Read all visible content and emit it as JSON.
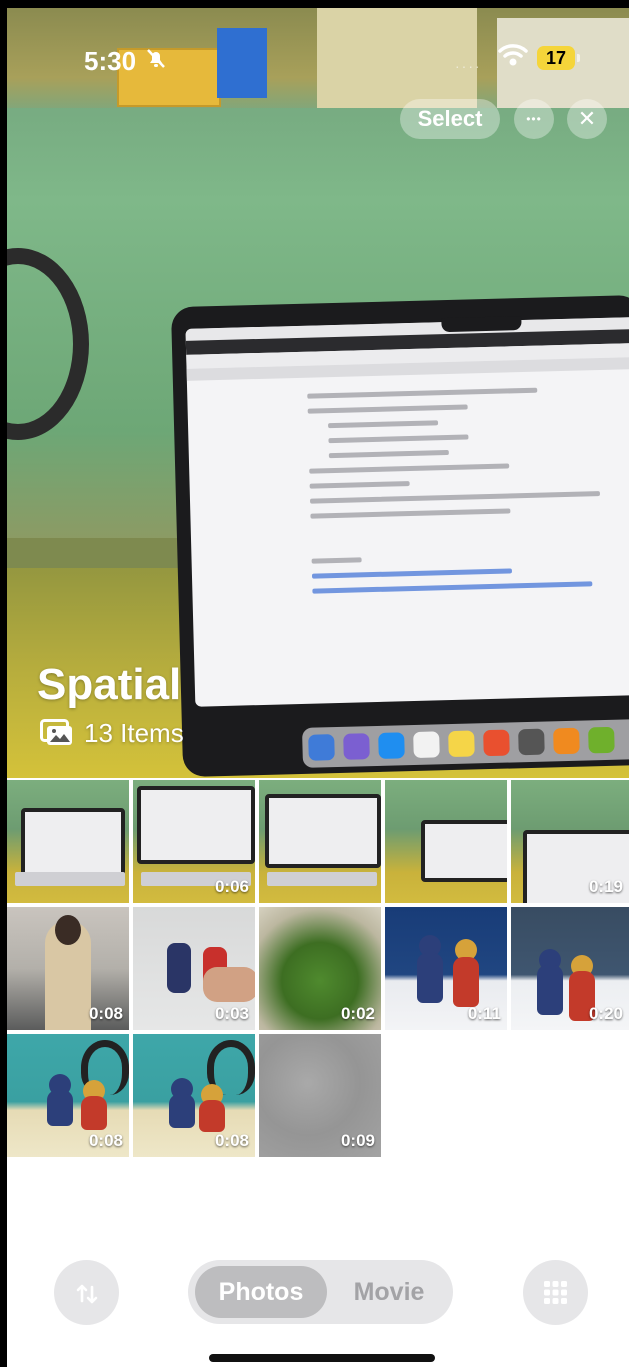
{
  "status_bar": {
    "time": "5:30",
    "battery": "17",
    "signal_dots": "····"
  },
  "toolbar": {
    "select_label": "Select",
    "more_glyph": "•••",
    "close_glyph": "✕"
  },
  "album": {
    "title": "Spatial",
    "count_label": "13 Items"
  },
  "thumbnails": [
    {
      "duration": "",
      "kind": "laptop"
    },
    {
      "duration": "0:06",
      "kind": "laptop"
    },
    {
      "duration": "",
      "kind": "laptop"
    },
    {
      "duration": "",
      "kind": "laptop"
    },
    {
      "duration": "0:19",
      "kind": "laptop"
    },
    {
      "duration": "0:08",
      "kind": "office"
    },
    {
      "duration": "0:03",
      "kind": "figures-hand"
    },
    {
      "duration": "0:02",
      "kind": "plant"
    },
    {
      "duration": "0:11",
      "kind": "figures-blue"
    },
    {
      "duration": "0:20",
      "kind": "figures-dark"
    },
    {
      "duration": "0:08",
      "kind": "figures-teal"
    },
    {
      "duration": "0:08",
      "kind": "figures-teal"
    },
    {
      "duration": "0:09",
      "kind": "blur"
    }
  ],
  "bottom_bar": {
    "sort_icon": "sort-arrows-icon",
    "segments": [
      "Photos",
      "Movie"
    ],
    "selected_segment": "Photos",
    "grid_icon": "grid-icon"
  },
  "colors": {
    "battery": "#f5d53a",
    "segment_selected": "#bdbdbf",
    "control_bg": "#e6e6e8"
  }
}
